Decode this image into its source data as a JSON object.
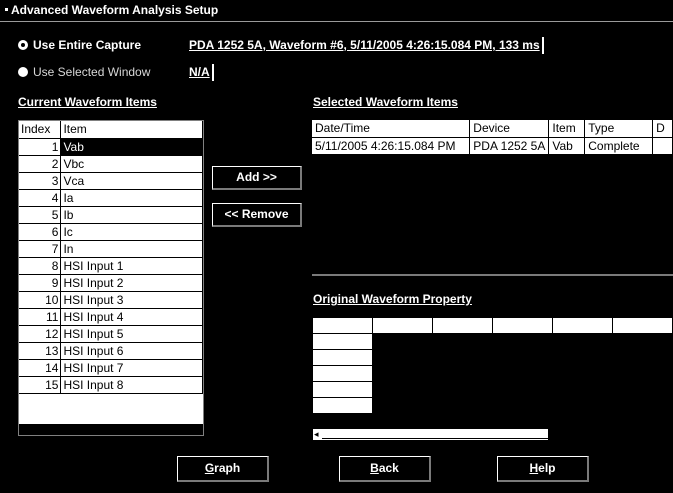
{
  "window": {
    "title": "Advanced Waveform Analysis Setup"
  },
  "options": {
    "entire_capture_label": "Use Entire Capture",
    "entire_capture_value": "PDA 1252 5A, Waveform #6, 5/11/2005 4:26:15.084 PM, 133 ms",
    "selected_window_label": "Use Selected Window",
    "selected_window_value": "N/A"
  },
  "current_items": {
    "heading": "Current Waveform Items",
    "columns": [
      "Index",
      "Item"
    ],
    "rows": [
      [
        "1",
        "Vab"
      ],
      [
        "2",
        "Vbc"
      ],
      [
        "3",
        "Vca"
      ],
      [
        "4",
        "Ia"
      ],
      [
        "5",
        "Ib"
      ],
      [
        "6",
        "Ic"
      ],
      [
        "7",
        "In"
      ],
      [
        "8",
        "HSI Input 1"
      ],
      [
        "9",
        "HSI Input 2"
      ],
      [
        "10",
        "HSI Input 3"
      ],
      [
        "11",
        "HSI Input 4"
      ],
      [
        "12",
        "HSI Input 5"
      ],
      [
        "13",
        "HSI Input 6"
      ],
      [
        "14",
        "HSI Input 7"
      ],
      [
        "15",
        "HSI Input 8"
      ]
    ],
    "selected_index": 0
  },
  "actions": {
    "add": "Add >>",
    "remove": "<< Remove"
  },
  "selected_items": {
    "heading": "Selected Waveform Items",
    "columns": [
      "Date/Time",
      "Device",
      "Item",
      "Type",
      "D"
    ],
    "rows": [
      [
        "5/11/2005 4:26:15.084 PM",
        "PDA 1252 5A",
        "Vab",
        "Complete",
        ""
      ]
    ]
  },
  "property": {
    "heading": "Original Waveform Property"
  },
  "buttons": {
    "graph": {
      "key": "G",
      "rest": "raph"
    },
    "back": {
      "key": "B",
      "rest": "ack"
    },
    "help": {
      "key": "H",
      "rest": "elp"
    }
  }
}
